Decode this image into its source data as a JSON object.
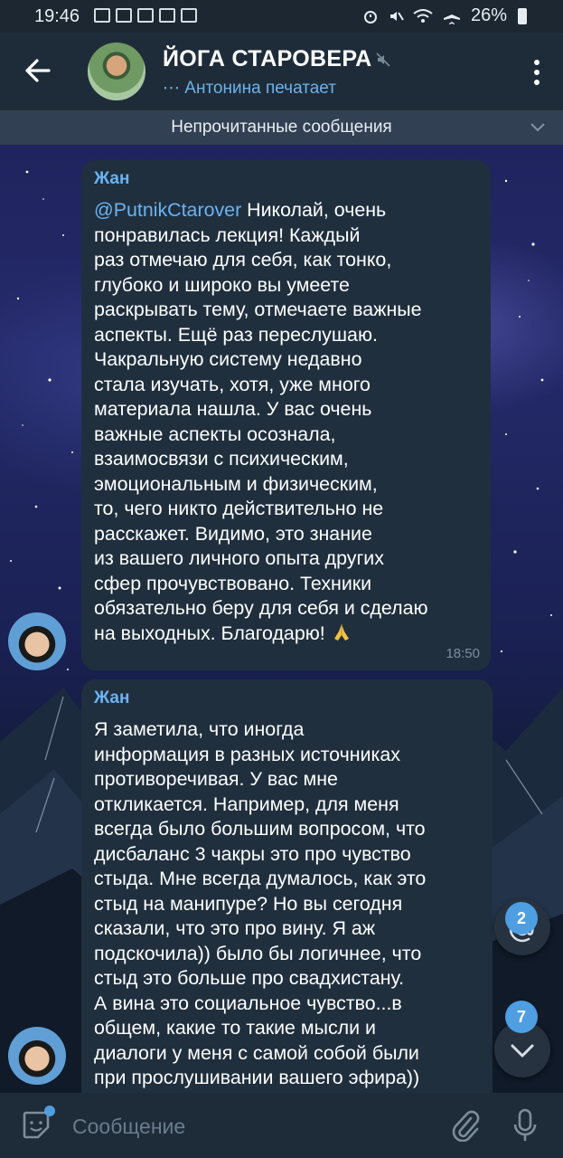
{
  "status_bar": {
    "time": "19:46",
    "battery": "26%"
  },
  "header": {
    "title": "ЙОГА СТАРОВЕРА",
    "typing": "Антонина печатает"
  },
  "unread_label": "Непрочитанные сообщения",
  "messages": [
    {
      "sender": "Жан",
      "mention": "@PutnikCtarover",
      "text": " Николай, очень\nпонравилась лекция! Каждый\nраз отмечаю для себя, как тонко,\nглубоко и широко вы умеете\nраскрывать тему, отмечаете важные\nаспекты. Ещё раз переслушаю.\nЧакральную систему недавно\nстала изучать, хотя, уже много\nматериала нашла. У вас очень\nважные аспекты осознала,\nвзаимосвязи с психическим,\nэмоциональным и физическим,\nто, чего никто действительно не\nрасскажет. Видимо, это знание\nиз вашего личного опыта других\nсфер прочувствовано. Техники\nобязательно беру для себя и сделаю\nна выходных. Благодарю! ",
      "emoji": "folded-hands",
      "time": "18:50"
    },
    {
      "sender": "Жан",
      "text": "Я заметила, что иногда\nинформация в разных источниках\nпротиворечивая. У вас мне\nоткликается. Например, для меня\nвсегда было большим вопросом, что\nдисбаланс 3 чакры это про чувство\nстыда. Мне всегда думалось, как это\nстыд на манипуре? Но вы сегодня\nсказали, что это про вину. Я аж\nподскочила)) было бы логичнее, что\nстыд это больше про свадхистану.\nА вина это социальное чувство...в\nобщем, какие то такие мысли и\nдиалоги у меня с самой собой были\nпри прослушивании вашего эфира))"
    }
  ],
  "badges": {
    "mentions": "2",
    "unread": "7"
  },
  "input": {
    "placeholder": "Сообщение"
  },
  "colors": {
    "accent": "#6ab3f3",
    "bubble": "#202f3e",
    "header": "#1e2c3a",
    "badge": "#4e9ee2"
  }
}
